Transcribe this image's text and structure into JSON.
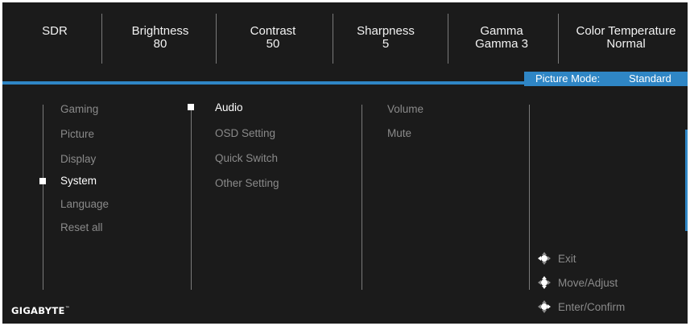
{
  "topbar": {
    "sdr": "SDR",
    "brightness_label": "Brightness",
    "brightness_value": "80",
    "contrast_label": "Contrast",
    "contrast_value": "50",
    "sharpness_label": "Sharpness",
    "sharpness_value": "5",
    "gamma_label": "Gamma",
    "gamma_value": "Gamma 3",
    "colortemp_label": "Color Temperature",
    "colortemp_value": "Normal"
  },
  "picture_mode": {
    "label": "Picture Mode:",
    "value": "Standard"
  },
  "main_menu": [
    "Gaming",
    "Picture",
    "Display",
    "System",
    "Language",
    "Reset all"
  ],
  "sub_menu": [
    "Audio",
    "OSD Setting",
    "Quick Switch",
    "Other Setting"
  ],
  "audio_menu": [
    "Volume",
    "Mute"
  ],
  "hints": {
    "exit": "Exit",
    "move": "Move/Adjust",
    "enter": "Enter/Confirm"
  },
  "logo": {
    "text": "GIGABYTE",
    "tm": "™"
  },
  "colors": {
    "accent": "#2f86c5",
    "background": "#1b1b1b",
    "inactive": "#8a8a8a"
  }
}
